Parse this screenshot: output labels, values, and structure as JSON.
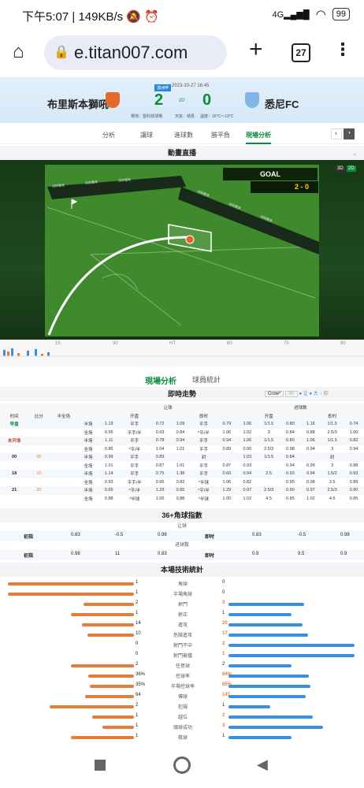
{
  "status": {
    "time": "下午5:07",
    "speed": "149KB/s",
    "battery": "99"
  },
  "browser": {
    "url": "e.titan007.com",
    "tabs": "27"
  },
  "match": {
    "badge": "澳洲甲",
    "datetime": "2023-10-27 16:45",
    "home": "布里斯本獅吼",
    "away": "悉尼FC",
    "home_score": "2",
    "away_score": "0",
    "half": "20'",
    "info1": "場地：盟科技球場",
    "info2": "天氣：晴見",
    "info3": "溫度：16°C～19°C"
  },
  "nav": [
    "分析",
    "讓球",
    "進球數",
    "勝平負",
    "現場分析"
  ],
  "live_title": "動畫直播",
  "pitch": {
    "goal": "GOAL",
    "goal_score": "2 - 0",
    "view3d": "3D",
    "view2d": "2D",
    "boards": [
      "球探體育",
      "球探體育",
      "球探體育",
      "球探體育",
      "球探體育",
      "球探體育",
      "球探體育",
      "球探體育",
      "球探體育",
      "球探體育",
      "球探體育",
      "球探體育",
      "球探體育"
    ]
  },
  "timeline": {
    "ticks": [
      "15",
      "30",
      "HT",
      "60",
      "75",
      "90"
    ]
  },
  "analysis_tabs": [
    "現場分析",
    "球員統計"
  ],
  "odds": {
    "title": "即時走勢",
    "company": "Crow*",
    "minute": "36'",
    "legend": [
      "让",
      "大",
      "欧"
    ],
    "group_heads": [
      "让球",
      "进球数"
    ],
    "headers": [
      "时间",
      "比分",
      "半全场",
      "开盘",
      "即时",
      "开盘",
      "即时"
    ],
    "rows": [
      [
        "早盘",
        "",
        "",
        "半场",
        "1.19",
        "平手",
        "0.72",
        "1.09",
        "平手",
        "0.79",
        "1.06",
        "1/1.5",
        "0.80",
        "1.16",
        "1/1.5",
        "0.74"
      ],
      [
        "",
        "",
        "",
        "全场",
        "0.95",
        "平手/半",
        "0.93",
        "0.84",
        "*平/半",
        "1.06",
        "1.02",
        "3",
        "0.84",
        "0.88",
        "2.5/3",
        "1.00"
      ],
      [
        "未开场",
        "",
        "",
        "半场",
        "1.11",
        "平手",
        "0.78",
        "0.94",
        "平手",
        "0.94",
        "1.06",
        "1/1.5",
        "0.80",
        "1.06",
        "1/1.5",
        "0.82"
      ],
      [
        "",
        "",
        "",
        "全场",
        "0.86",
        "*平/半",
        "1.04",
        "1.01",
        "平手",
        "0.89",
        "0.90",
        "2.5/3",
        "0.98",
        "0.94",
        "3",
        "0.94"
      ],
      [
        "00",
        "00",
        "",
        "半场",
        "0.99",
        "平手",
        "0.89",
        "",
        "封",
        "",
        "1.03",
        "1/1.5",
        "0.84",
        "",
        "封",
        ""
      ],
      [
        "",
        "",
        "",
        "全场",
        "1.01",
        "平手",
        "0.87",
        "1.01",
        "平手",
        "0.87",
        "0.93",
        "",
        "0.94",
        "0.99",
        "3",
        "0.88"
      ],
      [
        "18",
        "10",
        "",
        "半场",
        "1.14",
        "平手",
        "0.75",
        "1.38",
        "平手",
        "0.60",
        "0.94",
        "2.5",
        "0.93",
        "0.94",
        "1.5/2",
        "0.93"
      ],
      [
        "",
        "",
        "",
        "全场",
        "0.93",
        "平手/半",
        "0.95",
        "0.82",
        "*半球",
        "1.06",
        "0.82",
        "",
        "0.95",
        "0.98",
        "3.5",
        "0.89"
      ],
      [
        "21",
        "20",
        "",
        "半场",
        "0.65",
        "*平/半",
        "1.29",
        "0.65",
        "*平/半",
        "1.29",
        "0.97",
        "2.5/3",
        "0.90",
        "0.97",
        "2.5/3",
        "0.90"
      ],
      [
        "",
        "",
        "",
        "全场",
        "0.88",
        "*半球",
        "1.00",
        "0.88",
        "*半球",
        "1.00",
        "1.02",
        "4.5",
        "0.85",
        "1.02",
        "4.5",
        "0.85"
      ]
    ]
  },
  "corners": {
    "title": "36+角球指數",
    "sub1": "让球",
    "sub2": "进球数",
    "row1": [
      "初指",
      "0.83",
      "-0.5",
      "0.98",
      "即时",
      "0.83",
      "-0.5",
      "0.98"
    ],
    "row2": [
      "初指",
      "0.98",
      "11",
      "0.83",
      "即时",
      "0.9",
      "9.5",
      "0.9"
    ]
  },
  "tech": {
    "title": "本場技術統計",
    "rows": [
      {
        "home": "1",
        "label": "角球",
        "away": "0"
      },
      {
        "home": "1",
        "label": "半場角球",
        "away": "0"
      },
      {
        "home": "2",
        "label": "射門",
        "away": "3"
      },
      {
        "home": "1",
        "label": "射正",
        "away": "1"
      },
      {
        "home": "14",
        "label": "進攻",
        "away": "20"
      },
      {
        "home": "10",
        "label": "危險進攻",
        "away": "17"
      },
      {
        "home": "0",
        "label": "射門不中",
        "away": "2"
      },
      {
        "home": "0",
        "label": "射門被擋",
        "away": "1"
      },
      {
        "home": "2",
        "label": "任意球",
        "away": "2"
      },
      {
        "home": "36%",
        "label": "控球率",
        "away": "64%"
      },
      {
        "home": "35%",
        "label": "半場控球率",
        "away": "65%"
      },
      {
        "home": "94",
        "label": "傳球",
        "away": "147"
      },
      {
        "home": "2",
        "label": "犯規",
        "away": "1"
      },
      {
        "home": "1",
        "label": "越位",
        "away": "2"
      },
      {
        "home": "1",
        "label": "頭球成功",
        "away": "3"
      },
      {
        "home": "1",
        "label": "救球",
        "away": "1"
      }
    ]
  },
  "colors": {
    "home_bar": "#e87a3a",
    "away_bar": "#3a8fe0",
    "accent": "#0a8a3a"
  }
}
